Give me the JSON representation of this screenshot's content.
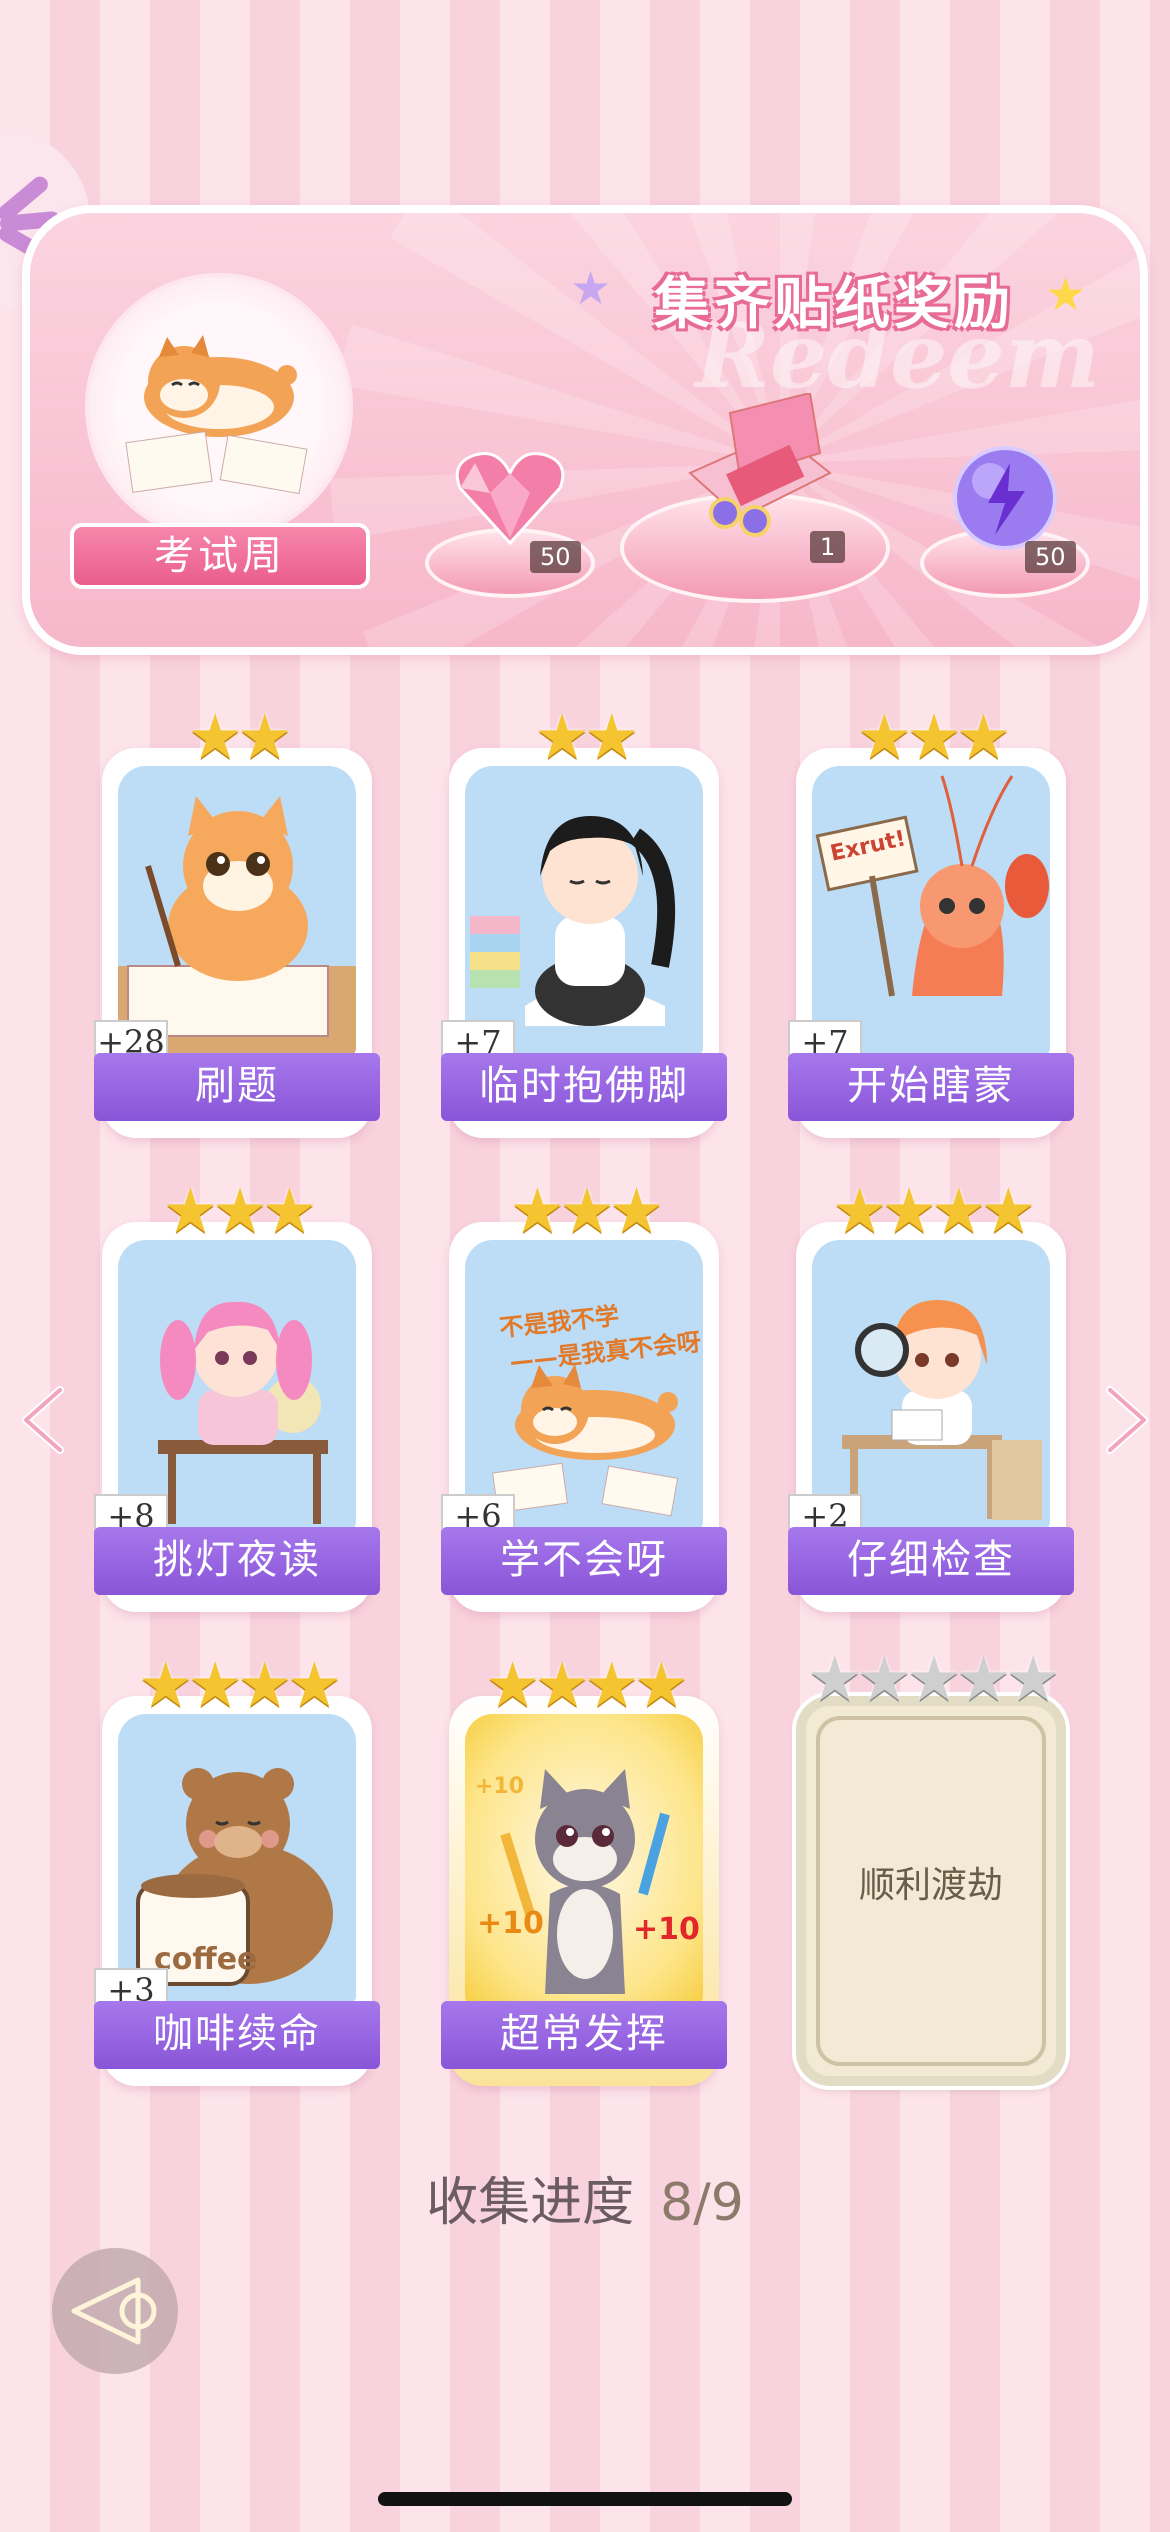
{
  "reward_panel": {
    "title": "集齐贴纸奖励",
    "watermark": "Redeem",
    "theme_name": "考试周",
    "rewards": [
      {
        "icon": "pink-heart-gem-icon",
        "count": "50"
      },
      {
        "icon": "gift-box-icon",
        "count": "1"
      },
      {
        "icon": "purple-energy-orb-icon",
        "count": "50"
      }
    ]
  },
  "stickers": [
    {
      "name": "刷题",
      "plus": "+28",
      "stars": "★★",
      "art": "cat-studying",
      "collected": true
    },
    {
      "name": "临时抱佛脚",
      "plus": "+7",
      "stars": "★★",
      "art": "girl-reading",
      "collected": true
    },
    {
      "name": "开始瞎蒙",
      "plus": "+7",
      "stars": "★★★",
      "art": "shrimp-sign",
      "sign_text": "Exrut!",
      "collected": true
    },
    {
      "name": "挑灯夜读",
      "plus": "+8",
      "stars": "★★★",
      "art": "girl-lamp",
      "collected": true
    },
    {
      "name": "学不会呀",
      "plus": "+6",
      "stars": "★★★",
      "art": "shiba-lying",
      "caption_line1": "不是我不学",
      "caption_line2": "——是我真不会呀",
      "collected": true
    },
    {
      "name": "仔细检查",
      "plus": "+2",
      "stars": "★★★★",
      "art": "girl-magnifier",
      "collected": true
    },
    {
      "name": "咖啡续命",
      "plus": "+3",
      "stars": "★★★★",
      "art": "bear-coffee",
      "cup_text": "coffee",
      "collected": true
    },
    {
      "name": "超常发挥",
      "plus": "",
      "stars": "★★★★",
      "art": "cat-pencil",
      "bonus": [
        "+10",
        "+10",
        "+10"
      ],
      "collected": true
    },
    {
      "name": "顺利渡劫",
      "plus": "",
      "stars": "★★★★★",
      "art": "locked",
      "collected": false
    }
  ],
  "progress": {
    "label": "收集进度",
    "value": "8/9"
  },
  "colors": {
    "accent_purple": "#9a62e3",
    "pink": "#f687ab",
    "star_gold": "#f5c431"
  }
}
